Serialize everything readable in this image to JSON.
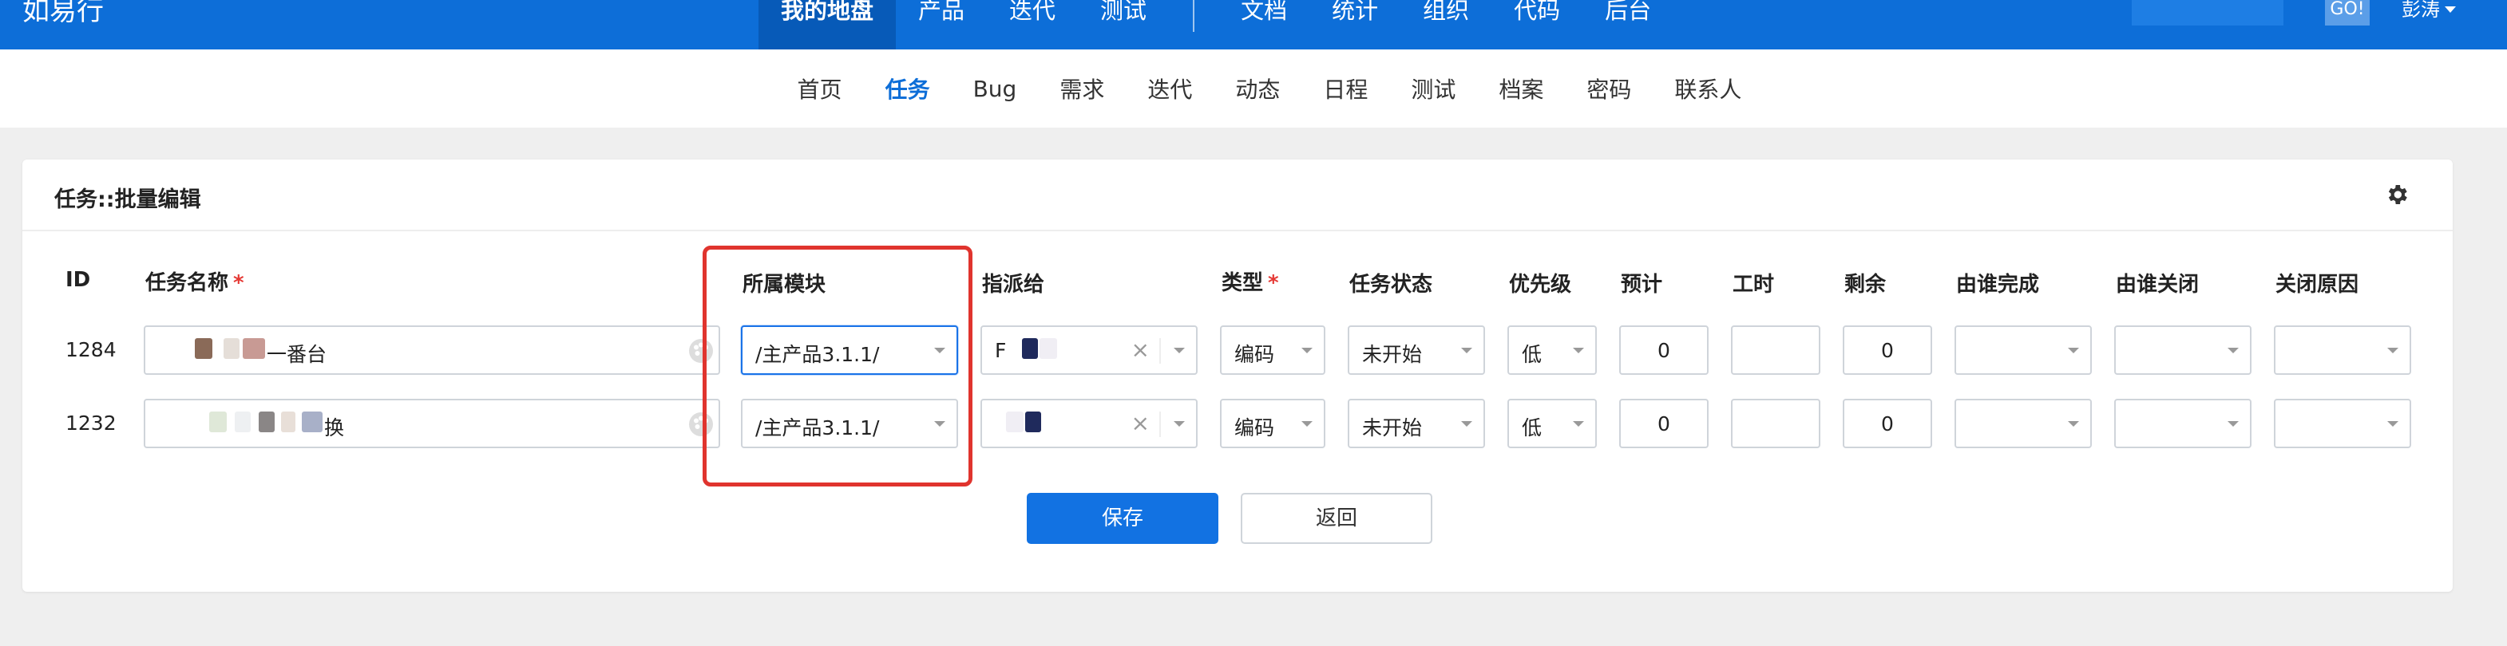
{
  "topbar": {
    "brand": "如易行",
    "nav": [
      "我的地盘",
      "产品",
      "迭代",
      "测试",
      "文档",
      "统计",
      "组织",
      "代码",
      "后台"
    ],
    "go_label": "GO!",
    "user_name": "彭涛"
  },
  "subnav": {
    "items": [
      "首页",
      "任务",
      "Bug",
      "需求",
      "迭代",
      "动态",
      "日程",
      "测试",
      "档案",
      "密码",
      "联系人"
    ]
  },
  "panel": {
    "title": "任务::批量编辑",
    "columns": {
      "id": "ID",
      "name": "任务名称",
      "module": "所属模块",
      "assignee": "指派给",
      "type": "类型",
      "status": "任务状态",
      "priority": "优先级",
      "estimate": "预计",
      "consumed": "工时",
      "left": "剩余",
      "finished_by": "由谁完成",
      "closed_by": "由谁关闭",
      "close_reason": "关闭原因"
    },
    "required_mark": "*",
    "rows": [
      {
        "id": "1284",
        "name_visible": "一番台",
        "module": "/主产品3.1.1/",
        "assignee": "F",
        "type": "编码",
        "status": "未开始",
        "priority": "低",
        "estimate": "0",
        "consumed": "",
        "left": "0",
        "finished_by": "",
        "closed_by": "",
        "close_reason": ""
      },
      {
        "id": "1232",
        "name_visible": "换",
        "module": "/主产品3.1.1/",
        "assignee": "",
        "type": "编码",
        "status": "未开始",
        "priority": "低",
        "estimate": "0",
        "consumed": "",
        "left": "0",
        "finished_by": "",
        "closed_by": "",
        "close_reason": ""
      }
    ],
    "save_label": "保存",
    "back_label": "返回"
  },
  "colors": {
    "topbar": "#0d6ed8",
    "accent": "#1272e2",
    "highlight": "#e0342e",
    "required": "#e53935"
  }
}
